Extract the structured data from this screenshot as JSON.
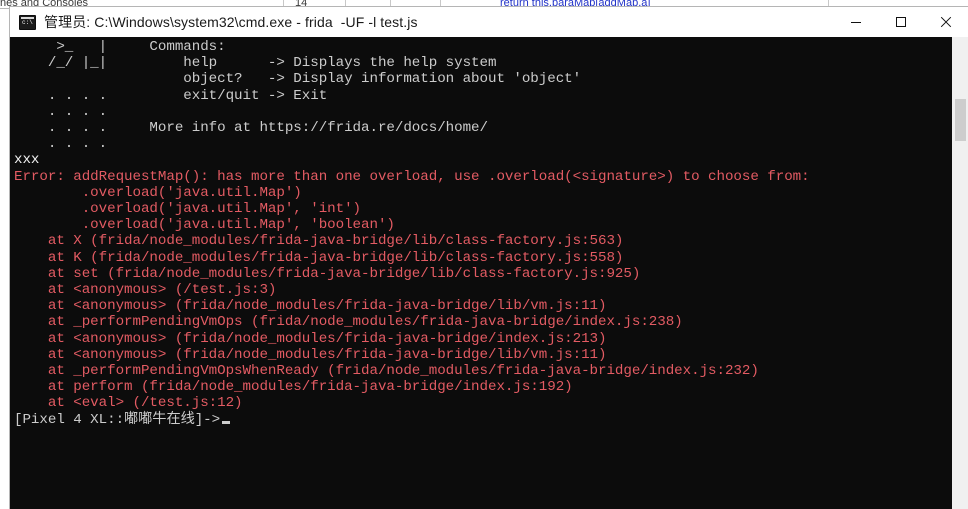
{
  "background": {
    "tab_label": "nes and Consoles",
    "gutter_number": "14",
    "code_fragment": "return this.paraMap[addMap.a]"
  },
  "window": {
    "title": "管理员: C:\\Windows\\system32\\cmd.exe - frida  -UF -l test.js",
    "icon": "cmd-console-icon",
    "controls": {
      "minimize": "minimize-button",
      "maximize": "maximize-button",
      "close": "close-button"
    }
  },
  "terminal": {
    "background_color": "#0c0c0c",
    "foreground_color": "#cccccc",
    "error_color": "#e35b63",
    "lines": [
      {
        "text": "     >_   |     Commands:",
        "color": "white"
      },
      {
        "text": "    /_/ |_|         help      -> Displays the help system",
        "color": "white"
      },
      {
        "text": "                    object?   -> Display information about 'object'",
        "color": "white"
      },
      {
        "text": "    . . . .         exit/quit -> Exit",
        "color": "white"
      },
      {
        "text": "    . . . .",
        "color": "white"
      },
      {
        "text": "    . . . .     More info at https://frida.re/docs/home/",
        "color": "white"
      },
      {
        "text": "    . . . .",
        "color": "white"
      },
      {
        "text": "xxx",
        "color": "bright"
      },
      {
        "text": "Error: addRequestMap(): has more than one overload, use .overload(<signature>) to choose from:",
        "color": "red"
      },
      {
        "text": "        .overload('java.util.Map')",
        "color": "red"
      },
      {
        "text": "        .overload('java.util.Map', 'int')",
        "color": "red"
      },
      {
        "text": "        .overload('java.util.Map', 'boolean')",
        "color": "red"
      },
      {
        "text": "    at X (frida/node_modules/frida-java-bridge/lib/class-factory.js:563)",
        "color": "red"
      },
      {
        "text": "    at K (frida/node_modules/frida-java-bridge/lib/class-factory.js:558)",
        "color": "red"
      },
      {
        "text": "    at set (frida/node_modules/frida-java-bridge/lib/class-factory.js:925)",
        "color": "red"
      },
      {
        "text": "    at <anonymous> (/test.js:3)",
        "color": "red"
      },
      {
        "text": "    at <anonymous> (frida/node_modules/frida-java-bridge/lib/vm.js:11)",
        "color": "red"
      },
      {
        "text": "    at _performPendingVmOps (frida/node_modules/frida-java-bridge/index.js:238)",
        "color": "red"
      },
      {
        "text": "    at <anonymous> (frida/node_modules/frida-java-bridge/index.js:213)",
        "color": "red"
      },
      {
        "text": "    at <anonymous> (frida/node_modules/frida-java-bridge/lib/vm.js:11)",
        "color": "red"
      },
      {
        "text": "    at _performPendingVmOpsWhenReady (frida/node_modules/frida-java-bridge/index.js:232)",
        "color": "red"
      },
      {
        "text": "    at perform (frida/node_modules/frida-java-bridge/index.js:192)",
        "color": "red"
      },
      {
        "text": "    at <eval> (/test.js:12)",
        "color": "red"
      }
    ],
    "prompt": "[Pixel 4 XL::嘟嘟牛在线]->"
  }
}
